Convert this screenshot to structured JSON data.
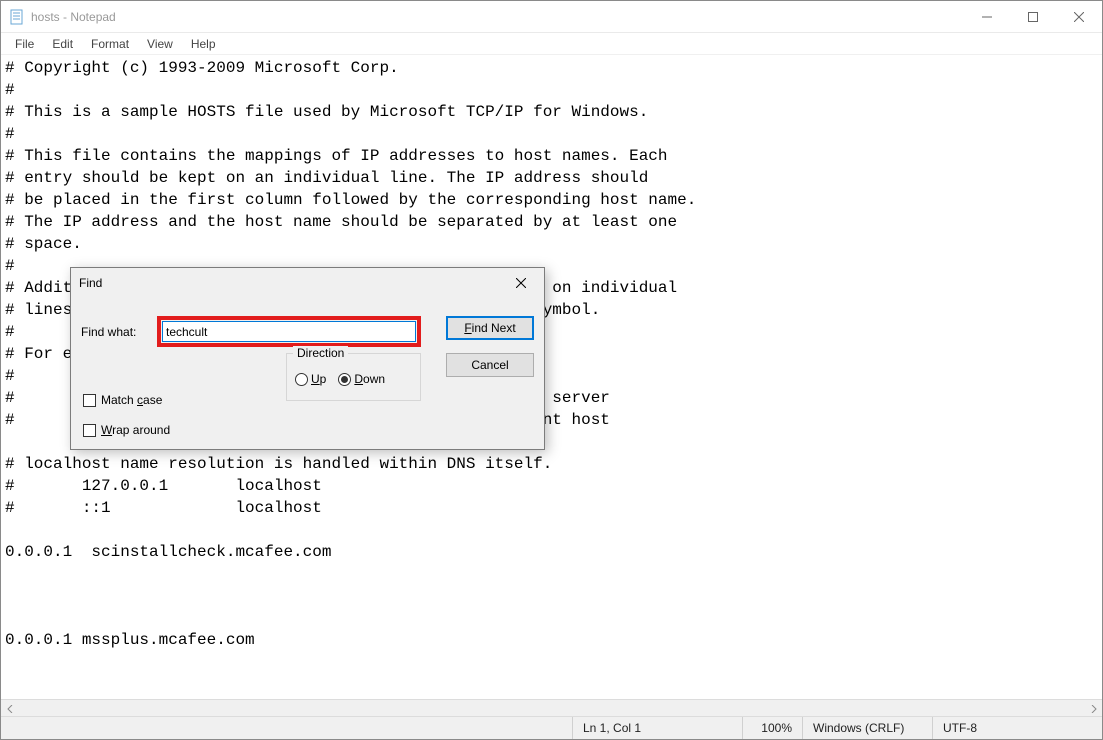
{
  "window": {
    "title": "hosts - Notepad"
  },
  "menu": {
    "file": "File",
    "edit": "Edit",
    "format": "Format",
    "view": "View",
    "help": "Help"
  },
  "document": {
    "text": "# Copyright (c) 1993-2009 Microsoft Corp.\n#\n# This is a sample HOSTS file used by Microsoft TCP/IP for Windows.\n#\n# This file contains the mappings of IP addresses to host names. Each\n# entry should be kept on an individual line. The IP address should\n# be placed in the first column followed by the corresponding host name.\n# The IP address and the host name should be separated by at least one\n# space.\n#\n# Additionally, comments (such as these) may be inserted on individual\n# lines or following the machine name denoted by a '#' symbol.\n#\n# For example:\n#\n#      102.54.94.97     rhino.acme.com          # source server\n#       38.25.63.10     x.acme.com              # x client host\n\n# localhost name resolution is handled within DNS itself.\n#\t127.0.0.1       localhost\n#\t::1             localhost\n\n0.0.0.1  scinstallcheck.mcafee.com\n\n\n\n0.0.0.1 mssplus.mcafee.com"
  },
  "find": {
    "title": "Find",
    "label": "Find what:",
    "value": "techcult",
    "find_next": "Find Next",
    "cancel": "Cancel",
    "direction_label": "Direction",
    "up": "Up",
    "down": "Down",
    "match_case": "Match case",
    "wrap_around": "Wrap around",
    "direction_value": "down"
  },
  "status": {
    "position": "Ln 1, Col 1",
    "zoom": "100%",
    "line_ending": "Windows (CRLF)",
    "encoding": "UTF-8"
  }
}
